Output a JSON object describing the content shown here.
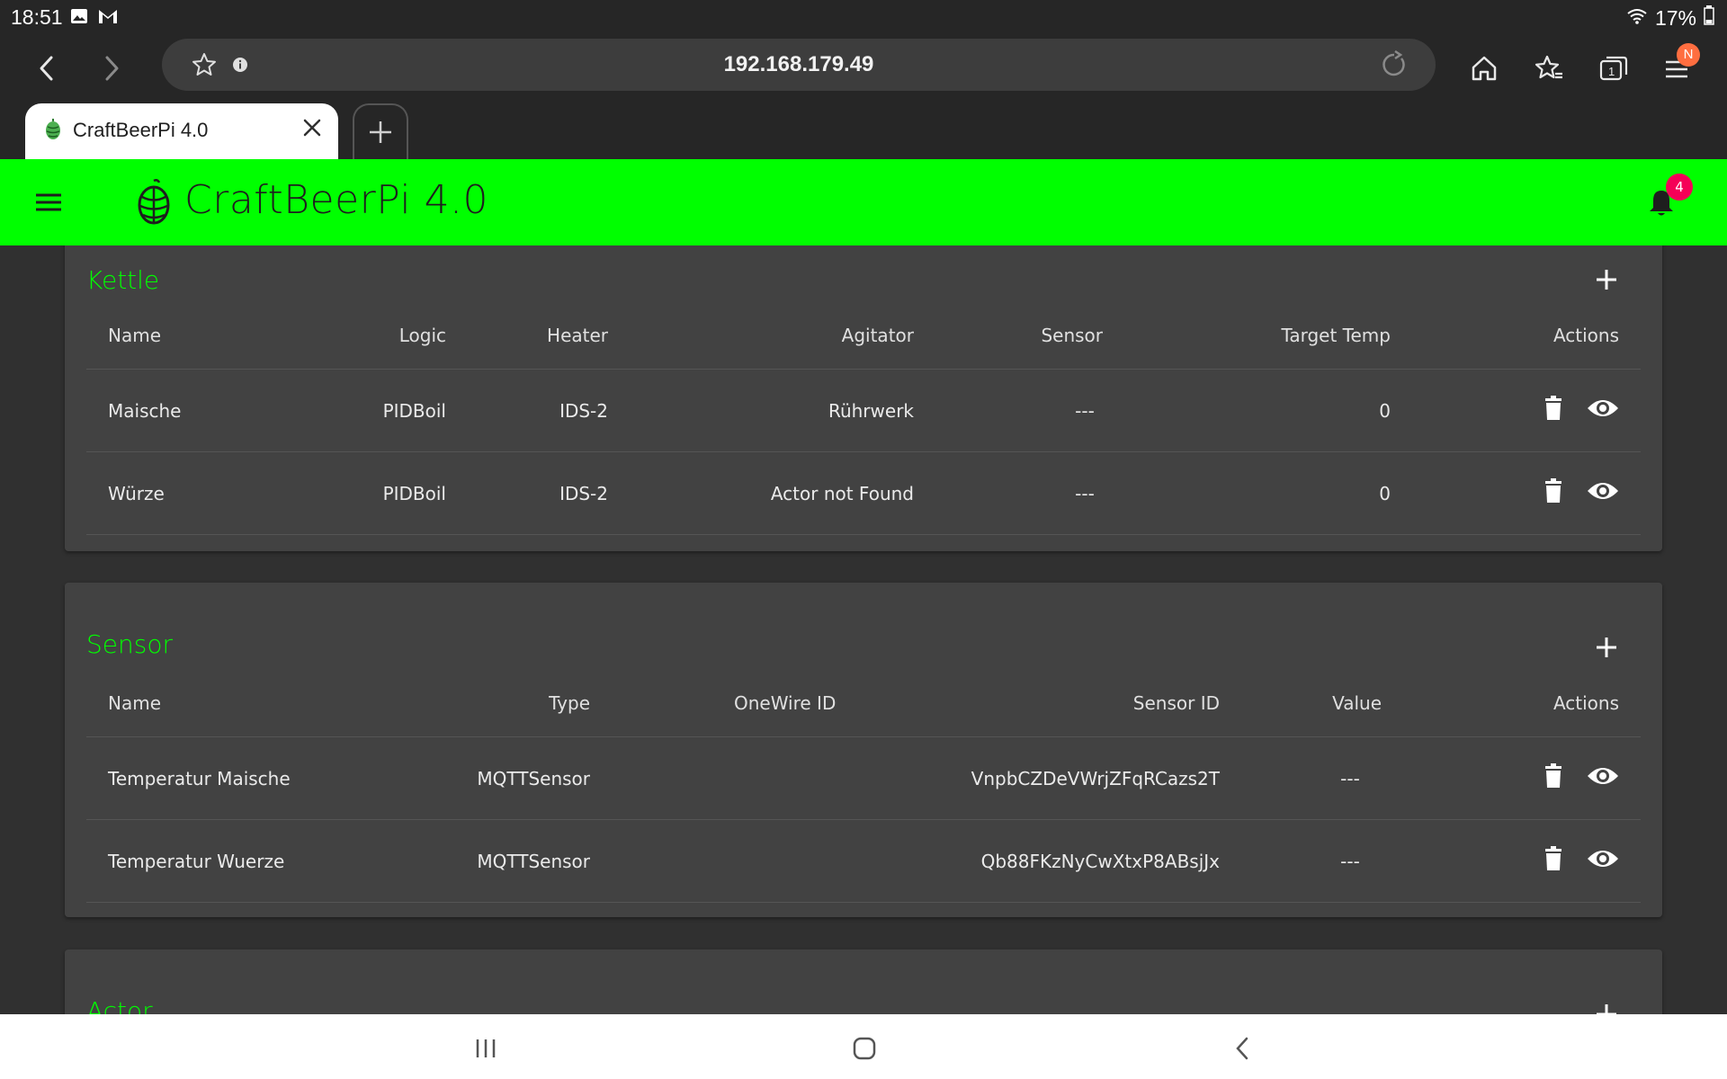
{
  "status": {
    "time": "18:51",
    "battery": "17%"
  },
  "browser": {
    "url": "192.168.179.49",
    "tab_title": "CraftBeerPi 4.0",
    "profile_initial": "N"
  },
  "app": {
    "title": "CraftBeerPi 4.0",
    "notification_count": "4"
  },
  "kettle": {
    "title": "Kettle",
    "headers": {
      "name": "Name",
      "logic": "Logic",
      "heater": "Heater",
      "agitator": "Agitator",
      "sensor": "Sensor",
      "target_temp": "Target Temp",
      "actions": "Actions"
    },
    "rows": [
      {
        "name": "Maische",
        "logic": "PIDBoil",
        "heater": "IDS-2",
        "agitator": "Rührwerk",
        "sensor": "---",
        "target_temp": "0"
      },
      {
        "name": "Würze",
        "logic": "PIDBoil",
        "heater": "IDS-2",
        "agitator": "Actor not Found",
        "sensor": "---",
        "target_temp": "0"
      }
    ]
  },
  "sensor": {
    "title": "Sensor",
    "headers": {
      "name": "Name",
      "type": "Type",
      "onewire_id": "OneWire ID",
      "sensor_id": "Sensor ID",
      "value": "Value",
      "actions": "Actions"
    },
    "rows": [
      {
        "name": "Temperatur Maische",
        "type": "MQTTSensor",
        "onewire_id": "",
        "sensor_id": "VnpbCZDeVWrjZFqRCazs2T",
        "value": "---"
      },
      {
        "name": "Temperatur Wuerze",
        "type": "MQTTSensor",
        "onewire_id": "",
        "sensor_id": "Qb88FKzNyCwXtxP8ABsjJx",
        "value": "---"
      }
    ]
  },
  "actor": {
    "title": "Actor"
  },
  "colors": {
    "accent": "#00ff00",
    "badge": "#f50057",
    "card": "#424242",
    "background": "#303030"
  }
}
